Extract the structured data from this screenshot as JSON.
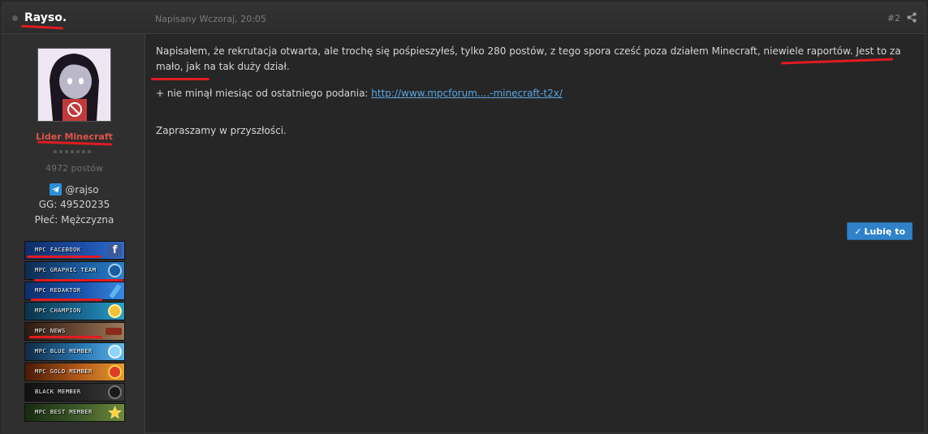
{
  "post": {
    "author": "Rayso.",
    "date": "Napisany Wczoraj, 20:05",
    "number": "#2"
  },
  "author_panel": {
    "group": "Lider Minecraft",
    "post_count": "4972 postów",
    "telegram": "@rajso",
    "gg": "GG: 49520235",
    "gender": "Płeć: Mężczyzna",
    "badges": [
      {
        "label": "MPC FACEBOOK",
        "color": "#1d4fa8",
        "icon": "facebook-icon"
      },
      {
        "label": "MPC GRAPHIC TEAM",
        "color": "#1b5c9e",
        "icon": "diamond-icon"
      },
      {
        "label": "MPC REDAKTOR",
        "color": "#1b57b0",
        "icon": "pencil-icon"
      },
      {
        "label": "MPC CHAMPION",
        "color": "#1a6b96",
        "icon": "trophy-icon"
      },
      {
        "label": "MPC NEWS",
        "color": "#6a4a35",
        "icon": "megaphone-icon"
      },
      {
        "label": "MPC BLUE MEMBER",
        "color": "#2a7ab5",
        "icon": "blue-star-icon"
      },
      {
        "label": "MPC GOLD MEMBER",
        "color": "#b25a1a",
        "icon": "gold-star-icon"
      },
      {
        "label": "BLACK MEMBER",
        "color": "#262626",
        "icon": "dark-star-icon"
      },
      {
        "label": "MPC BEST MEMBER",
        "color": "#3d5a2a",
        "icon": "star-icon"
      }
    ]
  },
  "content": {
    "paragraph1": "Napisałem, że rekrutacja otwarta, ale trochę się pośpieszyłeś, tylko 280 postów, z tego spora cześć poza działem Minecraft, niewiele raportów. Jest to za mało, jak na tak duży dział.",
    "paragraph2_prefix": "+ nie minął miesiąc od ostatniego podania: ",
    "link_text": "http://www.mpcforum....-minecraft-t2x/",
    "paragraph3": "Zapraszamy w przyszłości."
  },
  "actions": {
    "like_label": "Lubię to"
  },
  "colors": {
    "group": "#e0544b",
    "link": "#5aa6e6",
    "like_button": "#2f82c9",
    "annotation": "#e11b22"
  }
}
